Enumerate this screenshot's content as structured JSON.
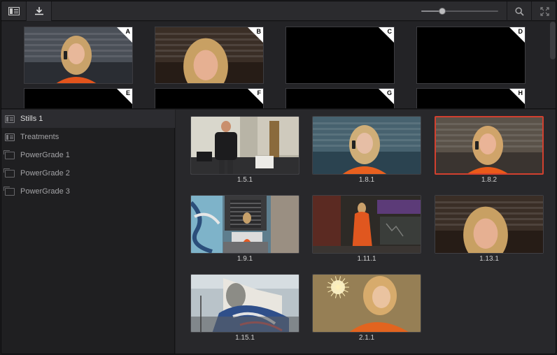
{
  "toolbar": {
    "sidebar_icon": "sidebar-toggle-icon",
    "import_icon": "import-icon",
    "search_icon": "search-icon",
    "expand_icon": "expand-icon",
    "zoom_level": 0.27
  },
  "memories": [
    {
      "letter": "A",
      "filled": true,
      "scene": "woman-phone"
    },
    {
      "letter": "B",
      "filled": true,
      "scene": "woman-closeup"
    },
    {
      "letter": "C",
      "filled": false
    },
    {
      "letter": "D",
      "filled": false
    },
    {
      "letter": "E",
      "filled": false
    },
    {
      "letter": "F",
      "filled": false
    },
    {
      "letter": "G",
      "filled": false
    },
    {
      "letter": "H",
      "filled": false
    }
  ],
  "sidebar": {
    "items": [
      {
        "label": "Stills 1",
        "type": "album",
        "active": true
      },
      {
        "label": "Treatments",
        "type": "album",
        "active": false
      },
      {
        "label": "PowerGrade 1",
        "type": "powergrade",
        "active": false
      },
      {
        "label": "PowerGrade 2",
        "type": "powergrade",
        "active": false
      },
      {
        "label": "PowerGrade 3",
        "type": "powergrade",
        "active": false
      }
    ]
  },
  "stills": [
    {
      "label": "1.5.1",
      "scene": "man-office",
      "selected": false
    },
    {
      "label": "1.8.1",
      "scene": "woman-phone-cool",
      "selected": false
    },
    {
      "label": "1.8.2",
      "scene": "woman-phone-warm",
      "selected": true
    },
    {
      "label": "1.9.1",
      "scene": "graffiti-street",
      "selected": false
    },
    {
      "label": "1.11.1",
      "scene": "woman-alley",
      "selected": false
    },
    {
      "label": "1.13.1",
      "scene": "woman-closeup",
      "selected": false
    },
    {
      "label": "1.15.1",
      "scene": "graffiti-wall",
      "selected": false
    },
    {
      "label": "2.1.1",
      "scene": "woman-sparkler",
      "selected": false
    }
  ],
  "colors": {
    "selection": "#d2402f",
    "memory_marker": "#ffffff"
  }
}
